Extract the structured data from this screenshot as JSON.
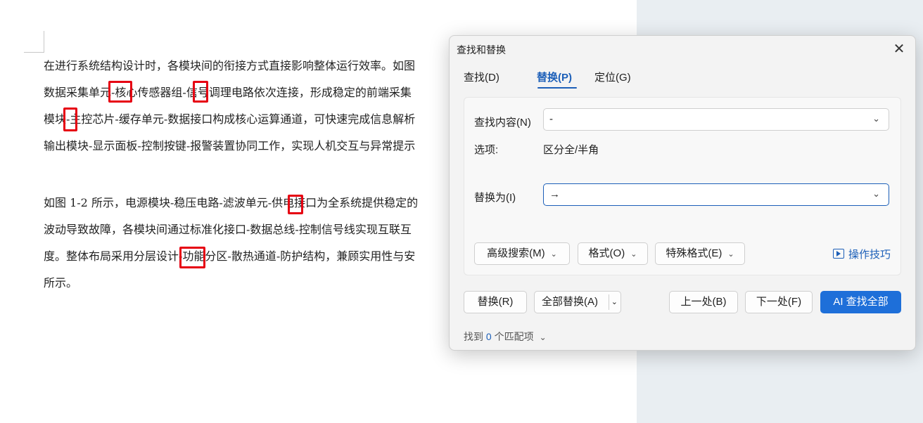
{
  "document": {
    "paragraph1": [
      "在进行系统结构设计时，各模块间的衔接方式直接影响整体运行效率。如图",
      "数据采集单元-核心传感器组-信号调理电路依次连接，形成稳定的前端采集",
      "模块-主控芯片-缓存单元-数据接口构成核心运算通道，可快速完成信息解析",
      "输出模块-显示面板-控制按键-报警装置协同工作，实现人机交互与异常提示"
    ],
    "paragraph2": [
      "如图 1-2 所示，电源模块-稳压电路-滤波单元-供电接口为全系统提供稳定的",
      "波动导致故障，各模块间通过标准化接口-数据总线-控制信号线实现互联互",
      "度。整体布局采用分层设计-功能分区-散热通道-防护结构，兼顾实用性与安",
      "所示。"
    ]
  },
  "dialog": {
    "title": "查找和替换",
    "close_icon": "close-icon",
    "tabs": [
      {
        "label": "查找(D)"
      },
      {
        "label": "替换(P)"
      },
      {
        "label": "定位(G)"
      }
    ],
    "active_tab": "替换(P)",
    "find_label": "查找内容(N)",
    "find_value": "-",
    "options_label": "选项:",
    "options_value": "区分全/半角",
    "replace_label": "替换为(I)",
    "replace_value": "→",
    "advanced_search": "高级搜索(M)",
    "format": "格式(O)",
    "special_format": "特殊格式(E)",
    "tips": "操作技巧",
    "replace_btn": "替换(R)",
    "replace_all_btn": "全部替换(A)",
    "prev_btn": "上一处(B)",
    "next_btn": "下一处(F)",
    "ai_find_all": "AI 查找全部",
    "found_prefix": "找到",
    "found_count": "0",
    "found_suffix": "个匹配项",
    "accent_color": "#1e6fd9"
  }
}
